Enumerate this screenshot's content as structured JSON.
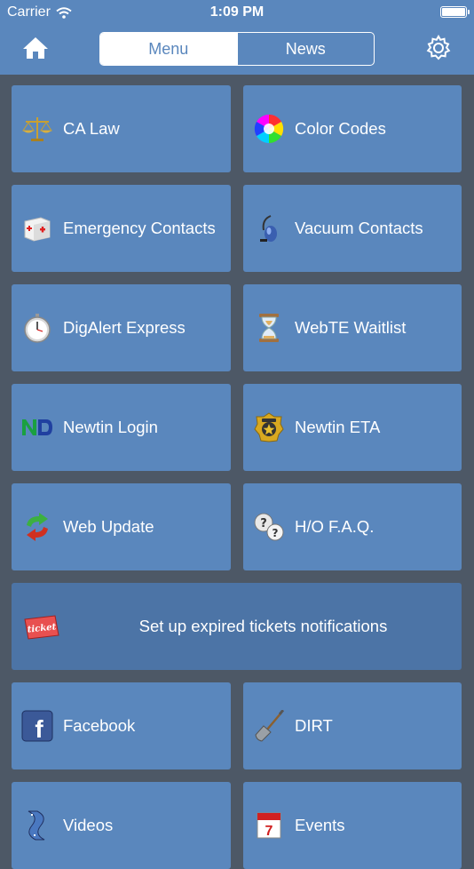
{
  "status_bar": {
    "carrier": "Carrier",
    "time": "1:09 PM"
  },
  "nav": {
    "tabs": [
      {
        "label": "Menu",
        "active": true
      },
      {
        "label": "News",
        "active": false
      }
    ]
  },
  "tiles": [
    {
      "label": "CA Law",
      "icon": "scales-icon"
    },
    {
      "label": "Color Codes",
      "icon": "color-wheel-icon"
    },
    {
      "label": "Emergency Contacts",
      "icon": "first-aid-icon"
    },
    {
      "label": "Vacuum Contacts",
      "icon": "vacuum-icon"
    },
    {
      "label": "DigAlert Express",
      "icon": "stopwatch-icon"
    },
    {
      "label": "WebTE Waitlist",
      "icon": "hourglass-icon"
    },
    {
      "label": "Newtin Login",
      "icon": "nd-logo-icon"
    },
    {
      "label": "Newtin ETA",
      "icon": "badge-icon"
    },
    {
      "label": "Web Update",
      "icon": "update-arrows-icon"
    },
    {
      "label": "H/O F.A.Q.",
      "icon": "question-bubbles-icon"
    },
    {
      "label": "Set up expired tickets notifications",
      "icon": "ticket-icon",
      "icon_text": "ticket"
    },
    {
      "label": "Facebook",
      "icon": "facebook-icon",
      "icon_text": "f"
    },
    {
      "label": "DIRT",
      "icon": "shovel-icon"
    },
    {
      "label": "Videos",
      "icon": "film-reel-icon"
    },
    {
      "label": "Events",
      "icon": "calendar-icon",
      "icon_text": "7"
    }
  ],
  "colors": {
    "header": "#5a87bd",
    "background": "#4d5866",
    "tile": "#5a87bd",
    "wide_tile": "#4c74a6"
  }
}
